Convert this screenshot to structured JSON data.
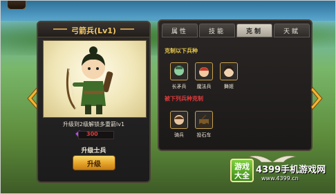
{
  "unit_panel": {
    "title": "弓箭兵(Lv1)",
    "hint": "升级到2级解锁多重箭lv1",
    "cost": "300",
    "upgrade_label": "升级士兵",
    "upgrade_button": "升级"
  },
  "tabs": [
    {
      "label": "属性",
      "active": false
    },
    {
      "label": "技能",
      "active": false
    },
    {
      "label": "克制",
      "active": true
    },
    {
      "label": "天赋",
      "active": false
    }
  ],
  "counter": {
    "strong_header": "克制以下兵种",
    "strong_units": [
      "长矛兵",
      "魔法兵",
      "舞姬"
    ],
    "weak_header": "被下列兵种克制",
    "weak_units": [
      "骑兵",
      "投石车"
    ]
  },
  "watermark": {
    "logo_line1": "游戏",
    "logo_line2": "大全",
    "site_name": "4399手机游戏网",
    "site_url": "www.4399.cn"
  },
  "colors": {
    "accent_gold": "#f2c765",
    "cost_red": "#e23a3a",
    "header_yellow": "#e8c84a"
  }
}
